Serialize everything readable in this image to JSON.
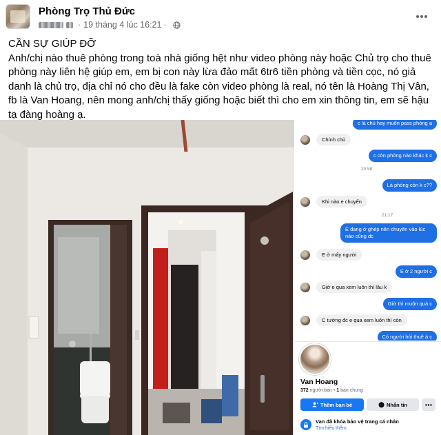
{
  "post": {
    "page_name": "Phòng Trọ Thủ Đức",
    "timestamp": "19 tháng 4 lúc 16:21",
    "meta_separator": "·",
    "audience_icon": "globe-icon",
    "more_icon": "more-horizontal-icon",
    "caption_heading": "CẦN SỰ GIÚP ĐỠ",
    "caption_body": "Anh/chị nào thuê phòng trong toà nhà giống hệt như video phòng này hoặc Chủ trọ cho thuê phòng này liên hệ giúp em, em bị con này lừa đảo mất 6tr6 tiền phòng và tiền cọc, nó giả danh là chủ trọ, địa chỉ nó cho đều là fake còn video phòng là real, nó tên là Hoàng Thị Vân, fb là Van Hoang, nên mong anh/chị thấy giống hoặc biết thì cho em xin thông tin, em sẽ hậu tạ đàng hoàng ạ."
  },
  "chat": {
    "messages": [
      {
        "side": "out",
        "text": "c là chủ hay muốn pass phòng ạ"
      },
      {
        "side": "in",
        "text": "Chính chủ"
      },
      {
        "side": "out",
        "text": "c còn phòng nào khác k c"
      },
      {
        "side": "time",
        "text": "20:58"
      },
      {
        "side": "out",
        "text": "Là phòng còn k c??"
      },
      {
        "side": "in",
        "text": "Khi nào e chuyển"
      },
      {
        "side": "time",
        "text": "21:17"
      },
      {
        "side": "out",
        "text": "E đang ở ghép nên chuyển vào lúc nào cũng dc"
      },
      {
        "side": "in",
        "text": "E ở mấy người"
      },
      {
        "side": "out",
        "text": "E ở 2 người c"
      },
      {
        "side": "in",
        "text": "Giờ e qua xem luôn thì lâu k"
      },
      {
        "side": "out",
        "text": "Giờ thì muộn quá c"
      },
      {
        "side": "in",
        "text": "C tưởng đc e qua xem luôn thì còn"
      },
      {
        "side": "out",
        "text": "Có người hỏi thuê à c"
      }
    ]
  },
  "profile": {
    "name": "Van Hoang",
    "friends_count": "372",
    "friends_label": "người bạn",
    "mutual_count": "1",
    "mutual_label": "bạn chung",
    "add_friend_label": "Thêm bạn bè",
    "message_label": "Nhắn tin",
    "lock_title": "Van đã khóa bảo vệ trang cá nhân",
    "lock_link": "Tìm hiểu thêm"
  },
  "colors": {
    "facebook_blue": "#1877f2",
    "messenger_bubble": "#1f6fe5",
    "secondary_text": "#65676b"
  }
}
